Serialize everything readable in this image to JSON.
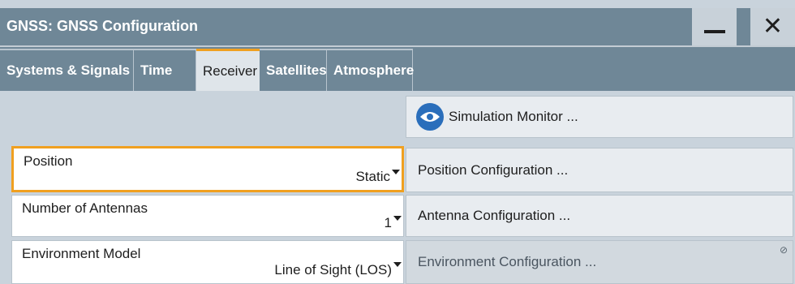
{
  "window": {
    "title": "GNSS: GNSS Configuration",
    "minimize_glyph": "—",
    "close_glyph": "✕"
  },
  "tabs": [
    {
      "label": "Systems & Signals",
      "active": false
    },
    {
      "label": "Time",
      "active": false
    },
    {
      "label": "Receiver",
      "active": true
    },
    {
      "label": "Satellites",
      "active": false
    },
    {
      "label": "Atmosphere",
      "active": false
    }
  ],
  "simulation_monitor": {
    "label": "Simulation Monitor ...",
    "icon": "eye-icon"
  },
  "fields": [
    {
      "label": "Position",
      "value": "Static",
      "focused": true
    },
    {
      "label": "Number of Antennas",
      "value": "1",
      "focused": false
    },
    {
      "label": "Environment Model",
      "value": "Line of Sight (LOS)",
      "focused": false
    }
  ],
  "config_buttons": [
    {
      "label": "Position Configuration ...",
      "enabled": true
    },
    {
      "label": "Antenna Configuration ...",
      "enabled": true
    },
    {
      "label": "Environment Configuration ...",
      "enabled": false
    }
  ],
  "colors": {
    "titlebar": "#6f8797",
    "accent_focus": "#f0a020",
    "panel_bg": "#c9d3dc",
    "icon_blue": "#2a6ebb"
  }
}
